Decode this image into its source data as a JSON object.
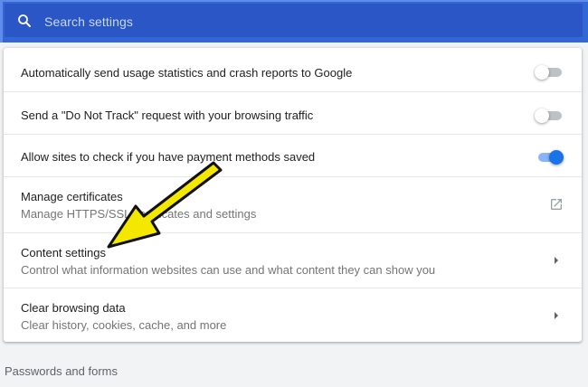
{
  "search": {
    "placeholder": "Search settings"
  },
  "rows": [
    {
      "title": "Automatically send usage statistics and crash reports to Google",
      "control": "toggle",
      "state": "off"
    },
    {
      "title": "Send a \"Do Not Track\" request with your browsing traffic",
      "control": "toggle",
      "state": "off"
    },
    {
      "title": "Allow sites to check if you have payment methods saved",
      "control": "toggle",
      "state": "on"
    },
    {
      "title": "Manage certificates",
      "subtitle": "Manage HTTPS/SSL certificates and settings",
      "control": "external-link-icon"
    },
    {
      "title": "Content settings",
      "subtitle": "Control what information websites can use and what content they can show you",
      "control": "chevron-right-icon"
    },
    {
      "title": "Clear browsing data",
      "subtitle": "Clear history, cookies, cache, and more",
      "control": "chevron-right-icon"
    }
  ],
  "section": {
    "heading": "Passwords and forms"
  },
  "colors": {
    "header": "#3367d6",
    "toggle_on": "#1a73e8",
    "annotation_arrow": "#f5e800"
  }
}
